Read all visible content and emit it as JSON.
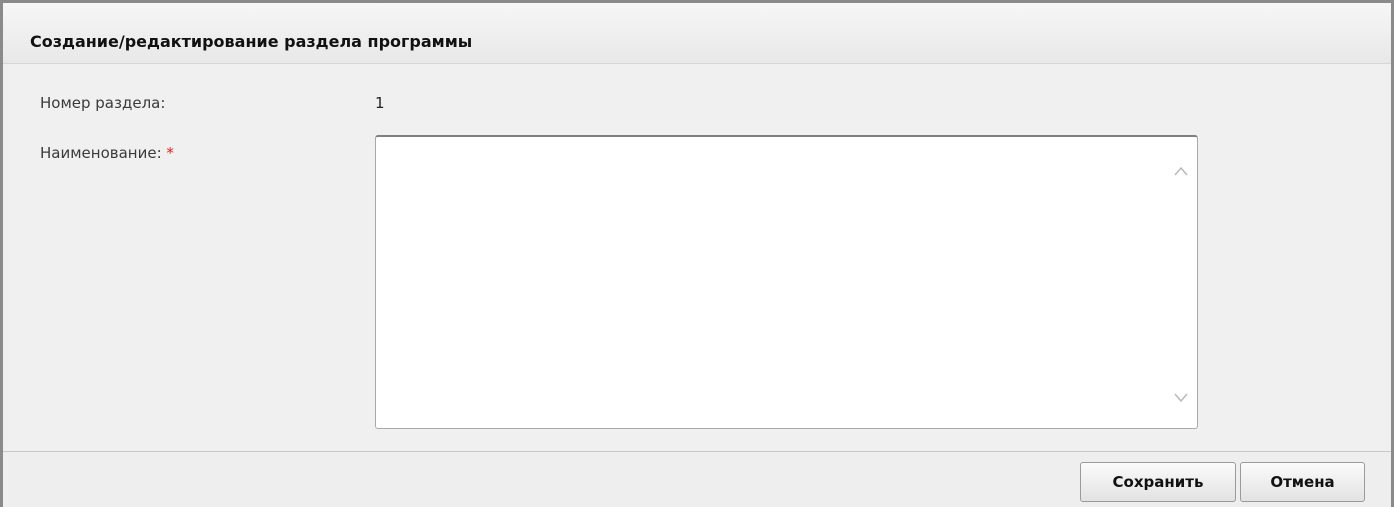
{
  "dialog": {
    "title": "Создание/редактирование раздела программы"
  },
  "form": {
    "section_number_label": "Номер раздела:",
    "section_number_value": "1",
    "name_label": "Наименование:",
    "name_required_marker": "*",
    "name_value": ""
  },
  "footer": {
    "save_label": "Сохранить",
    "cancel_label": "Отмена"
  },
  "icons": {
    "scroll_up": "chevron-up-icon",
    "scroll_down": "chevron-down-icon"
  },
  "colors": {
    "required": "#dd2222",
    "background": "#f0f0f0",
    "border": "#8a8a8a"
  }
}
